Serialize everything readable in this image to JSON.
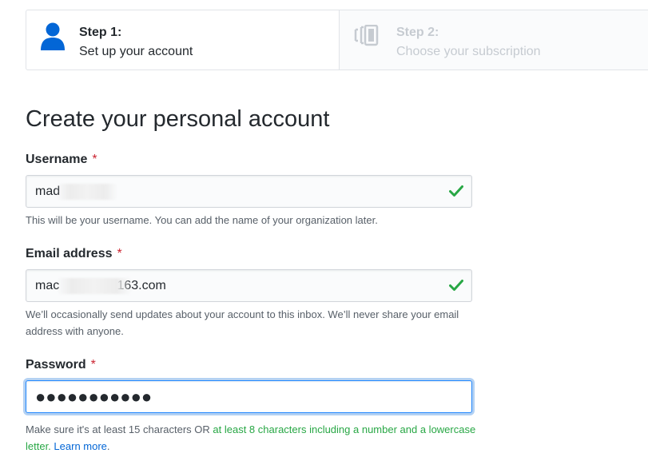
{
  "steps": [
    {
      "title": "Step 1:",
      "subtitle": "Set up your account",
      "icon": "person-icon",
      "state": "active"
    },
    {
      "title": "Step 2:",
      "subtitle": "Choose your subscription",
      "icon": "subscription-icon",
      "state": "inactive"
    }
  ],
  "form": {
    "heading": "Create your personal account",
    "required_marker": "*",
    "username": {
      "label": "Username",
      "value": "mad",
      "valid": true,
      "note": "This will be your username. You can add the name of your organization later."
    },
    "email": {
      "label": "Email address",
      "value_prefix": "mac",
      "value_suffix": "@163.com",
      "valid": true,
      "note": "We’ll occasionally send updates about your account to this inbox. We’ll never share your email address with anyone."
    },
    "password": {
      "label": "Password",
      "masked_value": "●●●●●●●●●●●",
      "focused": true,
      "note_part1": "Make sure it's at least 15 characters OR ",
      "note_part2": "at least 8 characters including a number and a lowercase letter.",
      "note_link": "Learn more",
      "note_end": "."
    }
  },
  "colors": {
    "active_icon": "#0366d6",
    "inactive_text": "#c6cbd1",
    "valid_check": "#28a745",
    "required": "#cb2431",
    "link": "#0366d6",
    "hint_green": "#28a745",
    "focus_ring": "#2188ff"
  }
}
